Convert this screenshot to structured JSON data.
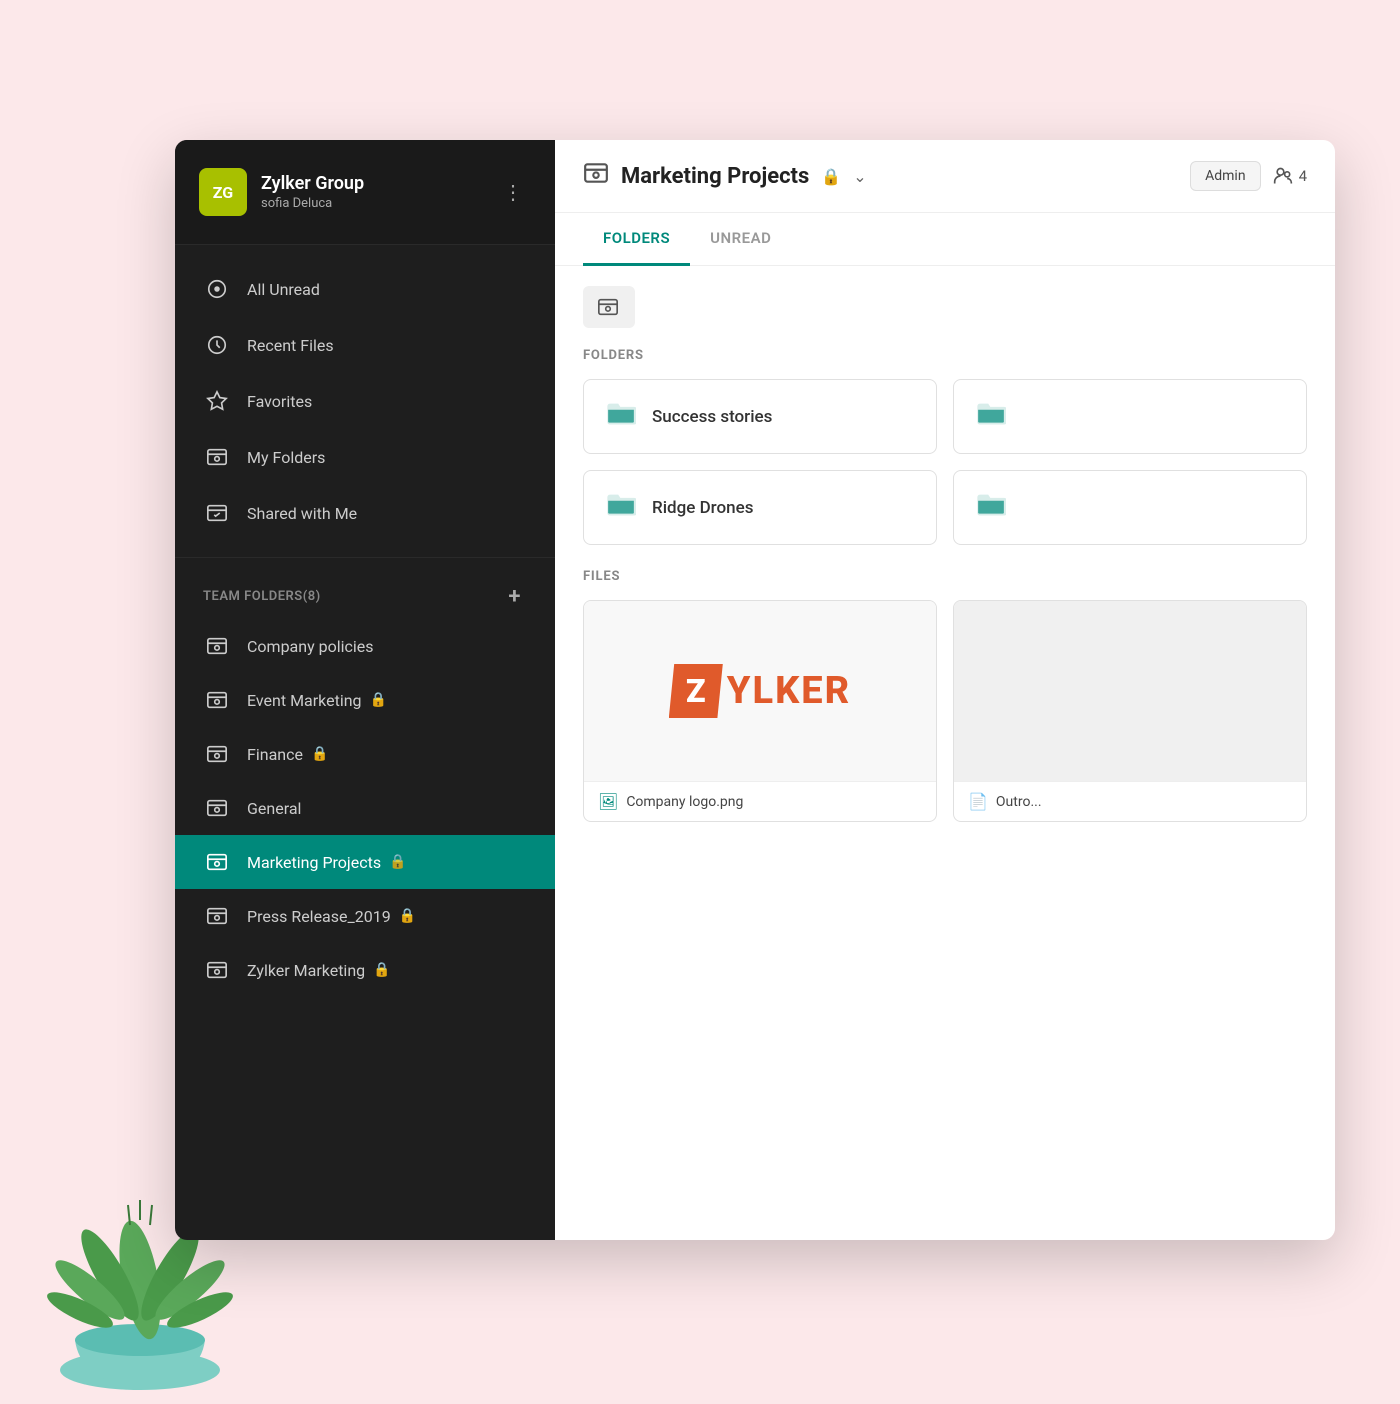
{
  "background": {
    "color": "#fce8ea"
  },
  "sidebar": {
    "avatar": "ZG",
    "org_name": "Zylker Group",
    "org_user": "sofia Deluca",
    "nav_items": [
      {
        "id": "all-unread",
        "label": "All Unread",
        "icon": "unread"
      },
      {
        "id": "recent-files",
        "label": "Recent Files",
        "icon": "recent"
      },
      {
        "id": "favorites",
        "label": "Favorites",
        "icon": "star"
      },
      {
        "id": "my-folders",
        "label": "My Folders",
        "icon": "folder"
      },
      {
        "id": "shared-with-me",
        "label": "Shared with Me",
        "icon": "shared"
      }
    ],
    "team_folders_header": "TEAM FOLDERS(8)",
    "team_folders": [
      {
        "id": "company-policies",
        "label": "Company policies",
        "locked": false
      },
      {
        "id": "event-marketing",
        "label": "Event Marketing",
        "locked": true
      },
      {
        "id": "finance",
        "label": "Finance",
        "locked": true
      },
      {
        "id": "general",
        "label": "General",
        "locked": false
      },
      {
        "id": "marketing-projects",
        "label": "Marketing Projects",
        "locked": true,
        "active": true
      },
      {
        "id": "press-release",
        "label": "Press Release_2019",
        "locked": true
      },
      {
        "id": "zylker-marketing",
        "label": "Zylker Marketing",
        "locked": true
      }
    ]
  },
  "main": {
    "header": {
      "title": "Marketing Projects",
      "role": "Admin",
      "members_count": "4"
    },
    "tabs": [
      {
        "id": "folders",
        "label": "FOLDERS",
        "active": true
      },
      {
        "id": "unread",
        "label": "UNREAD",
        "active": false
      }
    ],
    "sections": {
      "folders_label": "FOLDERS",
      "files_label": "FILES"
    },
    "folders": [
      {
        "id": "success-stories",
        "label": "Success stories"
      },
      {
        "id": "ridge-drones",
        "label": "Ridge Drones"
      },
      {
        "id": "folder-3",
        "label": ""
      },
      {
        "id": "folder-4",
        "label": ""
      }
    ],
    "files": [
      {
        "id": "company-logo",
        "label": "Company logo.png",
        "type": "image"
      },
      {
        "id": "outro",
        "label": "Outro...",
        "type": "doc"
      }
    ]
  }
}
